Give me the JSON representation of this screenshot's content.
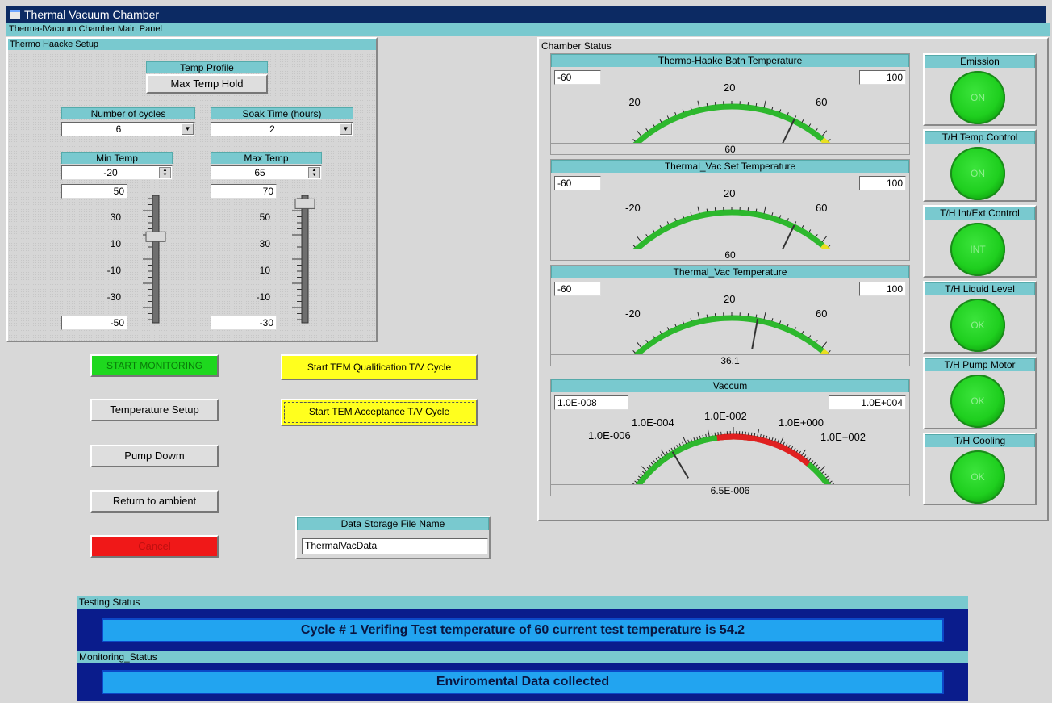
{
  "window": {
    "title": "Thermal Vacuum Chamber",
    "main_panel": "Therma-lVacuum Chamber Main Panel"
  },
  "setup": {
    "title": "Thermo Haacke Setup",
    "temp_profile": {
      "label": "Temp Profile",
      "value": "Max Temp Hold"
    },
    "cycles": {
      "label": "Number of cycles",
      "value": "6"
    },
    "soak": {
      "label": "Soak Time (hours)",
      "value": "2"
    },
    "min_temp": {
      "label": "Min Temp",
      "spin_value": "-20",
      "top_value": "50",
      "bottom_value": "-50",
      "ticks": [
        "30",
        "10",
        "-10",
        "-30"
      ],
      "slider_level": 0.69
    },
    "max_temp": {
      "label": "Max Temp",
      "spin_value": "65",
      "top_value": "70",
      "bottom_value": "-30",
      "ticks": [
        "50",
        "30",
        "10",
        "-10"
      ],
      "slider_level": 0.97
    }
  },
  "buttons": {
    "start_monitoring": "START MONITORING",
    "temperature_setup": "Temperature Setup",
    "pump_down": "Pump Dowm",
    "return_ambient": "Return to ambient",
    "cancel": "Cancel",
    "start_qual": "Start TEM Qualification T/V Cycle",
    "start_accept": "Start TEM Acceptance T/V Cycle"
  },
  "storage": {
    "label": "Data Storage File Name",
    "value": "ThermalVacData"
  },
  "chamber": {
    "title": "Chamber Status",
    "gauges": [
      {
        "title": "Thermo-Haake Bath Temperature",
        "min": "-60",
        "max": "100",
        "value": "60",
        "needle": 60,
        "labels": [
          "-20",
          "20",
          "60"
        ]
      },
      {
        "title": "Thermal_Vac Set Temperature",
        "min": "-60",
        "max": "100",
        "value": "60",
        "needle": 60,
        "labels": [
          "-20",
          "20",
          "60"
        ]
      },
      {
        "title": "Thermal_Vac Temperature",
        "min": "-60",
        "max": "100",
        "value": "36.1",
        "needle": 36.1,
        "labels": [
          "-20",
          "20",
          "60"
        ]
      }
    ],
    "vacuum": {
      "title": "Vaccum",
      "min": "1.0E-008",
      "max": "1.0E+004",
      "value": "6.5E-006",
      "needle": -5.19,
      "labels": [
        "1.0E-006",
        "1.0E-004",
        "1.0E-002",
        "1.0E+000",
        "1.0E+002"
      ]
    },
    "indicators": [
      {
        "label": "Emission",
        "state": "ON"
      },
      {
        "label": "T/H Temp Control",
        "state": "ON"
      },
      {
        "label": "T/H Int/Ext Control",
        "state": "INT"
      },
      {
        "label": "T/H Liquid Level",
        "state": "OK"
      },
      {
        "label": "T/H Pump Motor",
        "state": "OK"
      },
      {
        "label": "T/H Cooling",
        "state": "OK"
      }
    ]
  },
  "testing": {
    "title": "Testing Status",
    "message": "Cycle #   1 Verifing Test temperature  of  60 current test temperature is   54.2"
  },
  "monitoring": {
    "title": "Monitoring_Status",
    "message": "Enviromental Data collected"
  },
  "colors": {
    "title_bar": "#0c2a63",
    "caption": "#79c9cf",
    "status_bg": "#0a1c8c",
    "status_msg": "#22a4f0",
    "led_green": "#1fcf1f",
    "start_green": "#1ed81e",
    "cancel_red": "#f01818",
    "cycle_yellow": "#ffff1e"
  }
}
